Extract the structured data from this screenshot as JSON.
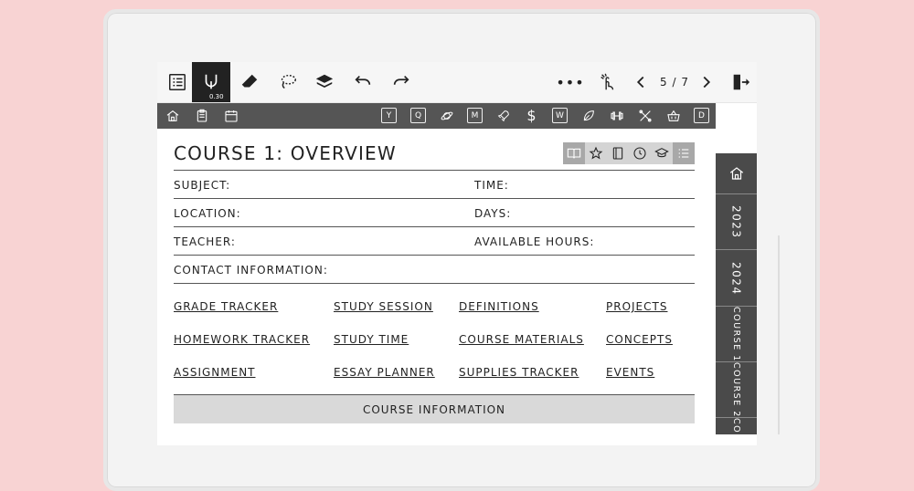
{
  "toolbar": {
    "icons": [
      "list-icon",
      "pen-icon",
      "eraser-icon",
      "lasso-icon",
      "layers-icon",
      "undo-icon",
      "redo-icon",
      "more-icon",
      "touch-icon",
      "prev-page-icon",
      "next-page-icon",
      "exit-icon"
    ],
    "pen_size": "0.30",
    "more_label": "•••",
    "page_indicator": "5 / 7"
  },
  "navbar": {
    "left_icons": [
      "home-icon",
      "clipboard-icon",
      "calendar-icon"
    ],
    "right_items": [
      "Y",
      "Q",
      "planet-icon",
      "M",
      "rocket-icon",
      "$",
      "W",
      "leaf-icon",
      "dumbbell-icon",
      "tools-icon",
      "basket-icon",
      "D"
    ]
  },
  "page": {
    "title": "COURSE 1: OVERVIEW",
    "title_icons": [
      "book-icon",
      "star-icon",
      "notebook-icon",
      "clock-icon",
      "graduation-cap-icon",
      "list-icon"
    ],
    "fields": {
      "subject": "SUBJECT:",
      "time": "TIME:",
      "location": "LOCATION:",
      "days": "DAYS:",
      "teacher": "TEACHER:",
      "available_hours": "AVAILABLE HOURS:",
      "contact": "CONTACT INFORMATION:"
    },
    "links": {
      "grade_tracker": "GRADE TRACKER",
      "study_session": "STUDY SESSION",
      "definitions": "DEFINITIONS",
      "projects": "PROJECTS",
      "homework_tracker": "HOMEWORK TRACKER",
      "study_time": "STUDY TIME",
      "course_materials": "COURSE MATERIALS",
      "concepts": "CONCEPTS",
      "assignment": "ASSIGNMENT",
      "essay_planner": "ESSAY PLANNER",
      "supplies_tracker": "SUPPLIES TRACKER",
      "events": "EVENTS"
    },
    "section_header": "COURSE INFORMATION"
  },
  "sidetabs": {
    "home_icon": "home-icon",
    "year_2023": "2023",
    "year_2024": "2024",
    "course1": "COURSE 1",
    "course2": "COURSE 2",
    "course3": "CO"
  },
  "colors": {
    "background": "#f8d3d3",
    "nav_dark": "#555555",
    "tab_dark": "#4a4a4a",
    "section_bar": "#d9d9d9"
  }
}
